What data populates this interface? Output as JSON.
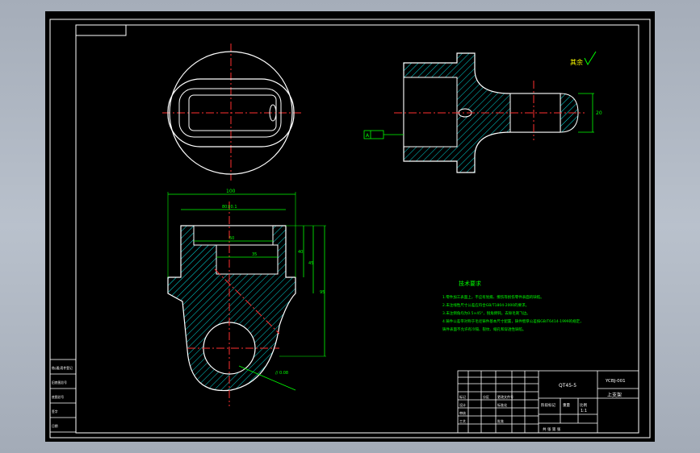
{
  "drawing": {
    "surface_finish_note": "其余",
    "datum_label": "A",
    "dims": {
      "overall_width": "100",
      "inner_width": "80±0.1",
      "slot_width": "50",
      "slot_width_2": "35",
      "depth_1": "40",
      "depth_2": "45",
      "height": "95",
      "right_height": "20",
      "tolerance": "// 0.08"
    },
    "tech_req": {
      "title": "技术要求",
      "lines": [
        "1.零件加工表面上，不应有划痕、擦伤等损伤零件表面的缺陷。",
        "2.未注线性尺寸公差应符合GB/T1804-2000的要求。",
        "3.未注倒角均为0.5×45°，锐角倒钝，去除毛刺飞边。",
        "4.铸件公差带对称于毛坯铸件基本尺寸配置，铸件壁厚公差按GB/T6414-1999的规定，",
        "   铸件表面不允许有冷隔、裂纹、缩孔和穿透性缺陷。"
      ]
    },
    "title_block": {
      "material": "QT45-5",
      "drawing_no": "YCBJ-001",
      "part_name": "上支架",
      "scale": "1:1",
      "rows": [
        "标记",
        "处数",
        "分区",
        "更改文件号",
        "签名",
        "日期"
      ],
      "roles": [
        "设计",
        "审核",
        "工艺"
      ],
      "std": "标准化",
      "approve": "批准",
      "stage": "阶段标记",
      "weight": "重量",
      "scale_label": "比例",
      "sheets": "共  张  第  张"
    },
    "left_strip": [
      "借(通)用件登记",
      "旧底图总号",
      "底图总号",
      "签字",
      "日期"
    ]
  }
}
